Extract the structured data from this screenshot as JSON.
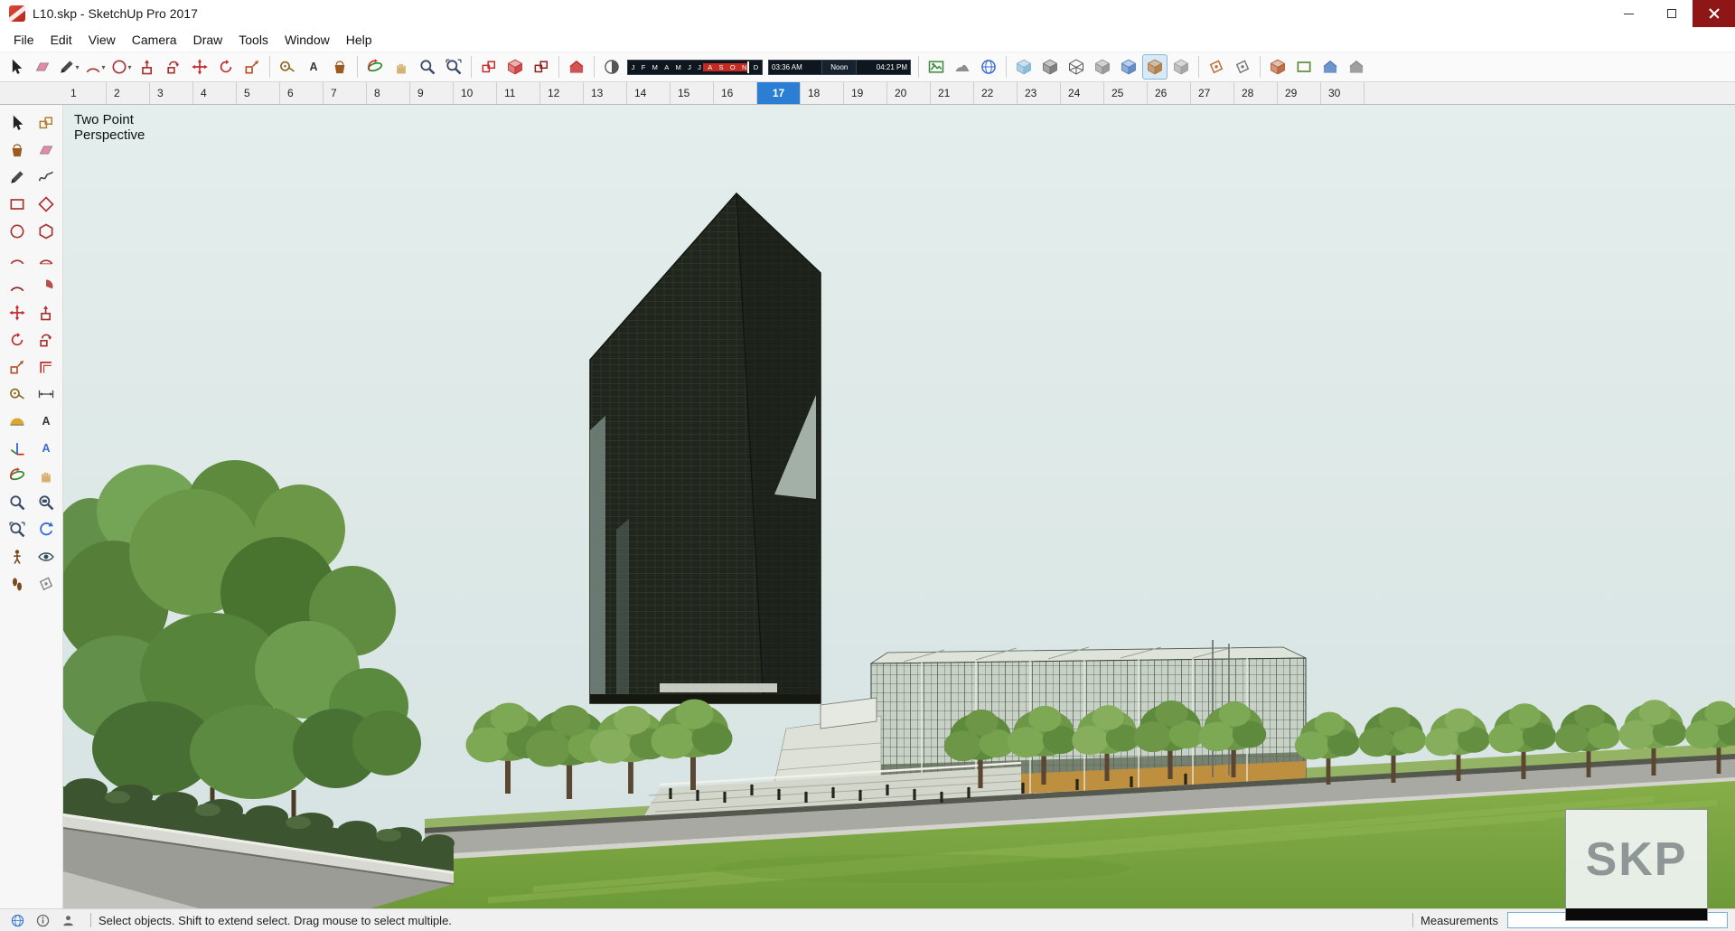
{
  "window": {
    "title": "L10.skp - SketchUp Pro 2017"
  },
  "menu": {
    "items": [
      "File",
      "Edit",
      "View",
      "Camera",
      "Draw",
      "Tools",
      "Window",
      "Help"
    ]
  },
  "toolbar": {
    "groups": [
      {
        "items": [
          {
            "name": "select-tool",
            "shape": "cursor",
            "color": "#222222"
          },
          {
            "name": "eraser-tool",
            "shape": "eraser",
            "color": "#e08cab"
          },
          {
            "name": "line-tool",
            "shape": "pencil",
            "color": "#4a4a4a",
            "dropdown": true
          },
          {
            "name": "arc-tool",
            "shape": "arc",
            "color": "#a83232",
            "dropdown": true
          },
          {
            "name": "shape-tool",
            "shape": "circle",
            "color": "#a83232",
            "dropdown": true
          },
          {
            "name": "push-pull-tool",
            "shape": "boxup",
            "color": "#a83232"
          },
          {
            "name": "follow-me-tool",
            "shape": "follow",
            "color": "#a83232"
          },
          {
            "name": "move-tool",
            "shape": "movearrows",
            "color": "#c42b2b"
          },
          {
            "name": "rotate-tool",
            "shape": "rotatearrows",
            "color": "#c42b2b"
          },
          {
            "name": "scale-tool",
            "shape": "scalebox",
            "color": "#b2542a"
          }
        ]
      },
      {
        "items": [
          {
            "name": "tape-measure-tool",
            "shape": "tape",
            "color": "#8a6a1f"
          },
          {
            "name": "text-tool",
            "shape": "textA",
            "color": "#333333"
          },
          {
            "name": "paint-bucket-tool",
            "shape": "bucket",
            "color": "#9a5a20"
          }
        ]
      },
      {
        "items": [
          {
            "name": "orbit-tool",
            "shape": "orbit",
            "color": "#c43a2a"
          },
          {
            "name": "pan-tool",
            "shape": "hand",
            "color": "#d8b070"
          },
          {
            "name": "zoom-tool",
            "shape": "magnifier",
            "color": "#3a4a66"
          },
          {
            "name": "zoom-extents-tool",
            "shape": "magext",
            "color": "#3a4a66"
          }
        ]
      },
      {
        "items": [
          {
            "name": "dc-interact-tool",
            "shape": "component",
            "color": "#c42b2b"
          },
          {
            "name": "dc-options-tool",
            "shape": "cube",
            "color": "#c42b2b"
          },
          {
            "name": "dc-attributes-tool",
            "shape": "component",
            "color": "#8e1f1f"
          }
        ]
      },
      {
        "items": [
          {
            "name": "warehouse-button",
            "shape": "house",
            "color": "#c42b2b"
          }
        ]
      },
      {
        "items": [
          {
            "name": "shadows-toggle-button",
            "shape": "shadowdisc",
            "color": "#555555"
          }
        ]
      },
      {
        "items": [
          {
            "name": "add-location-button",
            "shape": "photo",
            "color": "#3a8a3a"
          },
          {
            "name": "toggle-terrain-button",
            "shape": "terrain",
            "color": "#7a7a7a"
          },
          {
            "name": "photo-textures-button",
            "shape": "globe",
            "color": "#3a6ad4"
          }
        ]
      },
      {
        "items": [
          {
            "name": "style-xray-button",
            "shape": "cube",
            "color": "#7ab0d4"
          },
          {
            "name": "style-back-edges-button",
            "shape": "cube",
            "color": "#6a6a6a"
          },
          {
            "name": "style-wireframe-button",
            "shape": "wireframe",
            "color": "#555555"
          },
          {
            "name": "style-hidden-line-button",
            "shape": "cube",
            "color": "#8a8a8a"
          },
          {
            "name": "style-shaded-button",
            "shape": "cube",
            "color": "#4a7ac0"
          },
          {
            "name": "style-shaded-textures-button",
            "shape": "cube",
            "color": "#b07030",
            "active": true
          },
          {
            "name": "style-monochrome-button",
            "shape": "cube",
            "color": "#999999"
          }
        ]
      },
      {
        "items": [
          {
            "name": "section-plane-button",
            "shape": "sectionplane",
            "color": "#c06a30"
          },
          {
            "name": "section-cuts-button",
            "shape": "sectionplane",
            "color": "#777777"
          }
        ]
      },
      {
        "items": [
          {
            "name": "view-iso-button",
            "shape": "cube",
            "color": "#b2542a"
          },
          {
            "name": "view-top-button",
            "shape": "squareoutline",
            "color": "#5a8a3a"
          },
          {
            "name": "view-front-button",
            "shape": "house",
            "color": "#4a7ac0"
          },
          {
            "name": "view-back-button",
            "shape": "house",
            "color": "#8a8a8a"
          }
        ]
      }
    ],
    "shadows": {
      "months": [
        "J",
        "F",
        "M",
        "A",
        "M",
        "J",
        "J",
        "A",
        "S",
        "O",
        "N",
        "D"
      ],
      "time_start": "03:36 AM",
      "noon_label": "Noon",
      "time_end": "04:21 PM"
    }
  },
  "scene_tabs": {
    "tabs": [
      "1",
      "2",
      "3",
      "4",
      "5",
      "6",
      "7",
      "8",
      "9",
      "10",
      "11",
      "12",
      "13",
      "14",
      "15",
      "16",
      "17",
      "18",
      "19",
      "20",
      "21",
      "22",
      "23",
      "24",
      "25",
      "26",
      "27",
      "28",
      "29",
      "30"
    ],
    "active": "17"
  },
  "left_palette": {
    "tools": [
      {
        "name": "select-tool",
        "shape": "cursor",
        "color": "#222222"
      },
      {
        "name": "make-component-tool",
        "shape": "component",
        "color": "#b08030"
      },
      {
        "name": "paint-bucket-tool",
        "shape": "bucket",
        "color": "#9a5a20"
      },
      {
        "name": "eraser-tool",
        "shape": "eraser",
        "color": "#e08cab"
      },
      {
        "name": "line-tool",
        "shape": "pencil",
        "color": "#4a4a4a"
      },
      {
        "name": "freehand-tool",
        "shape": "squiggle",
        "color": "#4a4a4a"
      },
      {
        "name": "rectangle-tool",
        "shape": "squareoutline",
        "color": "#a83232"
      },
      {
        "name": "rotated-rectangle-tool",
        "shape": "squarerot",
        "color": "#a83232"
      },
      {
        "name": "circle-tool",
        "shape": "circle",
        "color": "#a83232"
      },
      {
        "name": "polygon-tool",
        "shape": "hexagon",
        "color": "#a83232"
      },
      {
        "name": "arc-tool",
        "shape": "arc",
        "color": "#a83232"
      },
      {
        "name": "two-point-arc-tool",
        "shape": "arc2",
        "color": "#a83232"
      },
      {
        "name": "three-point-arc-tool",
        "shape": "arc",
        "color": "#8e1f1f"
      },
      {
        "name": "pie-tool",
        "shape": "pie",
        "color": "#a83232"
      },
      {
        "name": "move-tool",
        "shape": "movearrows",
        "color": "#c42b2b"
      },
      {
        "name": "push-pull-tool",
        "shape": "boxup",
        "color": "#a83232"
      },
      {
        "name": "rotate-tool",
        "shape": "rotatearrows",
        "color": "#c42b2b"
      },
      {
        "name": "follow-me-tool",
        "shape": "follow",
        "color": "#a83232"
      },
      {
        "name": "scale-tool",
        "shape": "scalebox",
        "color": "#b2542a"
      },
      {
        "name": "offset-tool",
        "shape": "offset",
        "color": "#c42b2b"
      },
      {
        "name": "tape-measure-tool",
        "shape": "tape",
        "color": "#8a6a1f"
      },
      {
        "name": "dimension-tool",
        "shape": "dimension",
        "color": "#444444"
      },
      {
        "name": "protractor-tool",
        "shape": "protractor",
        "color": "#d4a017"
      },
      {
        "name": "text-tool",
        "shape": "textA",
        "color": "#333333"
      },
      {
        "name": "axes-tool",
        "shape": "axes",
        "color": "#c42b2b"
      },
      {
        "name": "3d-text-tool",
        "shape": "textA",
        "color": "#3a6ad4"
      },
      {
        "name": "orbit-tool",
        "shape": "orbit",
        "color": "#c43a2a"
      },
      {
        "name": "pan-tool",
        "shape": "hand",
        "color": "#d8b070"
      },
      {
        "name": "zoom-tool",
        "shape": "magnifier",
        "color": "#3a4a66"
      },
      {
        "name": "zoom-window-tool",
        "shape": "magwin",
        "color": "#3a4a66"
      },
      {
        "name": "zoom-extents-tool",
        "shape": "magext",
        "color": "#3a4a66"
      },
      {
        "name": "previous-view-tool",
        "shape": "prevarrow",
        "color": "#3a6ad4"
      },
      {
        "name": "position-camera-tool",
        "shape": "poscam",
        "color": "#7a4a22"
      },
      {
        "name": "look-around-tool",
        "shape": "eye",
        "color": "#33505e"
      },
      {
        "name": "walk-tool",
        "shape": "feet",
        "color": "#7a4a22"
      },
      {
        "name": "section-plane-tool",
        "shape": "sectionplane",
        "color": "#888888"
      }
    ]
  },
  "viewport": {
    "camera_label_line1": "Two Point",
    "camera_label_line2": "Perspective",
    "watermark_text": "SKP"
  },
  "status_bar": {
    "hint": "Select objects. Shift to extend select. Drag mouse to select multiple.",
    "measurements_label": "Measurements",
    "measurements_value": ""
  }
}
